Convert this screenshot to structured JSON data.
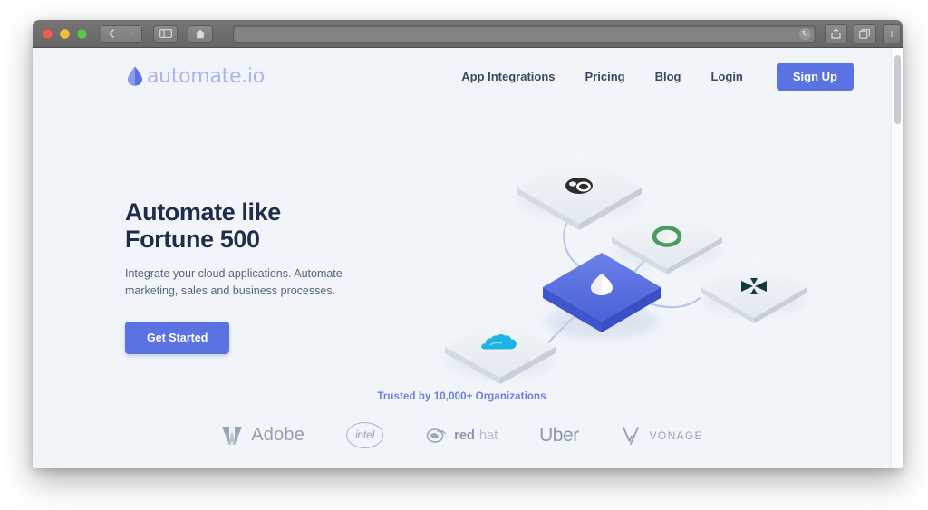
{
  "browser": {
    "traffic_lights": [
      "close",
      "minimize",
      "maximize"
    ],
    "back_label": "‹",
    "forward_label": "›",
    "sidebar_icon": "sidebar-icon",
    "home_icon": "home-icon",
    "address_value": "",
    "address_placeholder": "",
    "reload_glyph": "↻",
    "share_icon": "share-icon",
    "tabs_icon": "tab-overview-icon",
    "new_tab_label": "+"
  },
  "site": {
    "logo": {
      "text": "automate.io",
      "mark": "droplet-icon",
      "mark_color": "#5b72e2",
      "text_color": "#aab4ef"
    },
    "nav": {
      "links": [
        {
          "label": "App Integrations"
        },
        {
          "label": "Pricing"
        },
        {
          "label": "Blog"
        },
        {
          "label": "Login"
        }
      ],
      "signup_label": "Sign Up",
      "signup_color": "#5b72e2"
    },
    "hero": {
      "headline": "Automate like\nFortune 500",
      "subhead": "Integrate your cloud applications. Automate\nmarketing, sales and business processes.",
      "cta_label": "Get Started",
      "headline_color": "#1f2d4a",
      "accent_color": "#5b72e2"
    },
    "illustration": {
      "name": "isometric-integration-flow",
      "center_tile": {
        "icon": "automate-droplet-icon",
        "color": "#5b72e2"
      },
      "tiles": [
        {
          "icon": "app-dark-icon",
          "color": "#2b2b2b",
          "position": "top"
        },
        {
          "icon": "hubspot-circle-icon",
          "color": "#4c9a5d",
          "position": "upper-right"
        },
        {
          "icon": "xero-butterfly-icon",
          "color": "#13393a",
          "position": "right"
        },
        {
          "icon": "salesforce-cloud-icon",
          "color": "#1fb2e6",
          "position": "lower-left"
        }
      ],
      "tile_color": "#e9edf3"
    },
    "trust": {
      "label": "Trusted by 10,000+ Organizations",
      "label_color": "#6a7fe0",
      "brands": [
        {
          "name": "Adobe",
          "mark": "adobe-a-icon"
        },
        {
          "name": "intel",
          "mark": "intel-oval-icon"
        },
        {
          "name": "redhat",
          "name_bold": "red",
          "name_light": "hat",
          "mark": "redhat-shadowman-icon"
        },
        {
          "name": "Uber",
          "mark": "none"
        },
        {
          "name": "VONAGE",
          "mark": "vonage-v-icon"
        }
      ]
    }
  }
}
